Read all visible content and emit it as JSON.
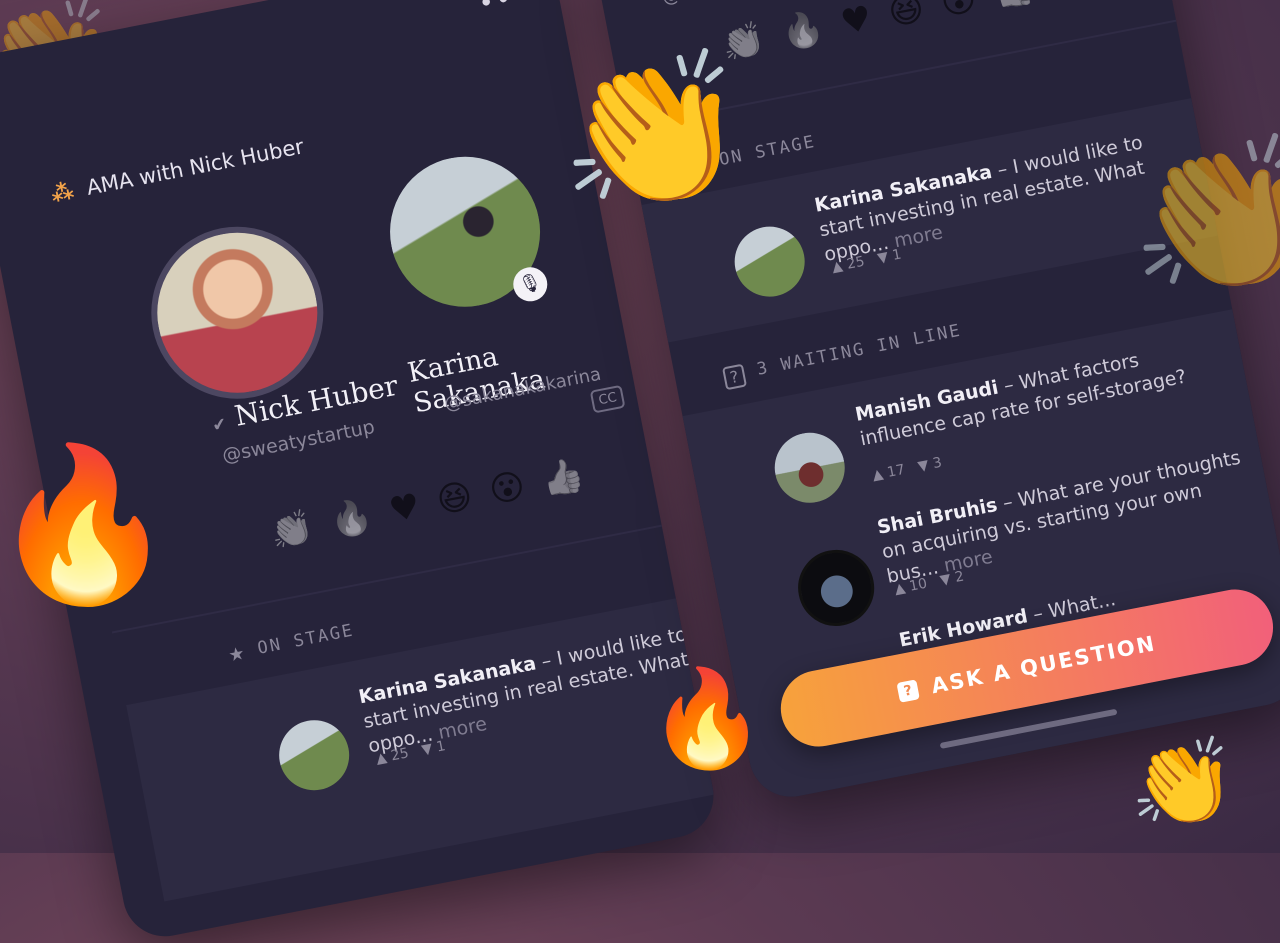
{
  "app_title": "AMA with Nick Huber",
  "menu_icon": "more-dots-icon",
  "hosts": [
    {
      "name": "Nick Huber",
      "handle": "@sweatystartup",
      "verified": true
    },
    {
      "name": "Karina Sakanaka",
      "handle": "@sakanakakarina",
      "muted": true
    }
  ],
  "reactions": [
    "clap-icon",
    "fire-icon",
    "heart-icon",
    "laugh-icon",
    "wow-icon",
    "thumbs-up-icon"
  ],
  "cc_label": "CC",
  "on_stage": {
    "label": "ON STAGE",
    "question": {
      "author": "Karina Sakanaka",
      "text": " – I would like to start investing in real estate. What oppo...",
      "more": "more",
      "upvotes": "25",
      "downvotes": "1"
    }
  },
  "waiting": {
    "label": "3 WAITING IN LINE",
    "questions": [
      {
        "author": "Manish Gaudi",
        "text": " – What factors influence cap rate for self-storage?",
        "more": "",
        "upvotes": "17",
        "downvotes": "3"
      },
      {
        "author": "Shai Bruhis",
        "text": " – What are your thoughts on acquiring vs. starting your own bus...",
        "more": "more",
        "upvotes": "10",
        "downvotes": "2"
      },
      {
        "author": "Erik Howard",
        "text": " – What...",
        "more": "",
        "upvotes": "",
        "downvotes": ""
      }
    ]
  },
  "ask_button": "ASK A QUESTION",
  "colors": {
    "phone_bg": "#26233a",
    "accent_start": "#f7a23b",
    "accent_end": "#f2607a"
  }
}
